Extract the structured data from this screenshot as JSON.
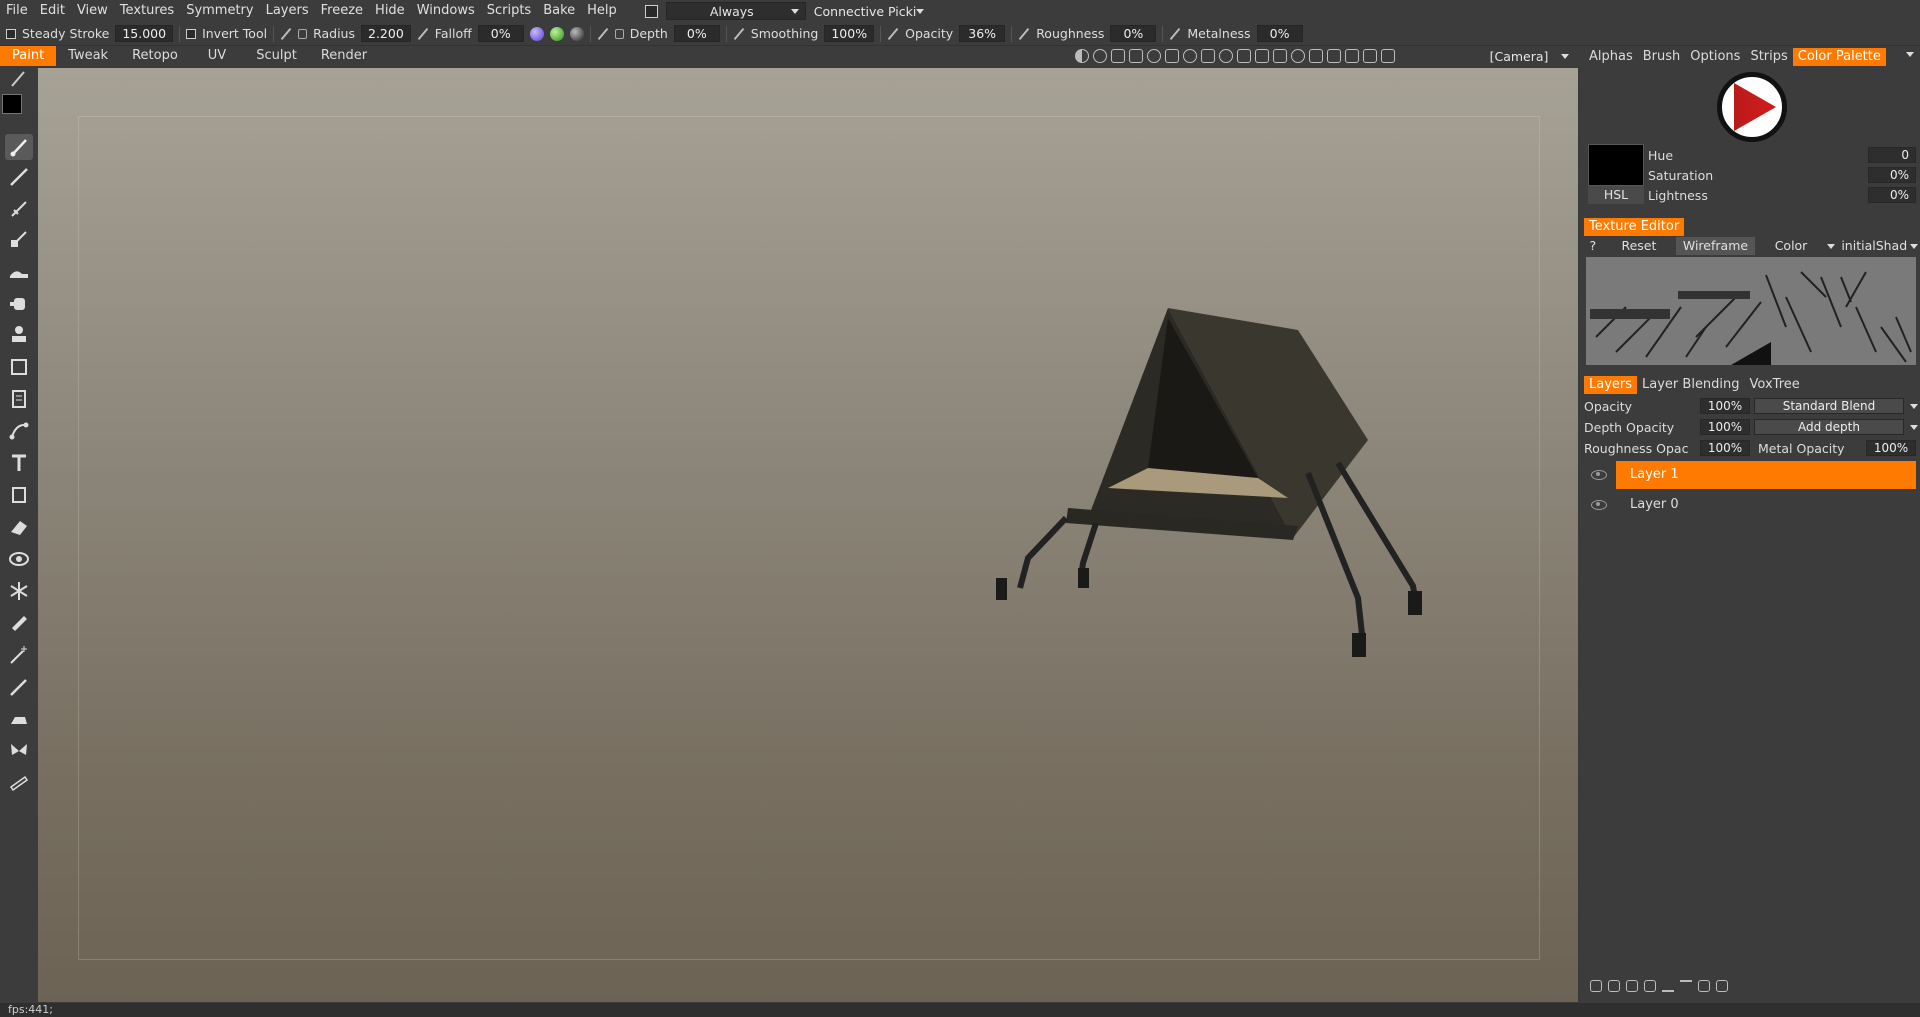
{
  "menu": {
    "items": [
      "File",
      "Edit",
      "View",
      "Textures",
      "Symmetry",
      "Layers",
      "Freeze",
      "Hide",
      "Windows",
      "Scripts",
      "Bake",
      "Help"
    ],
    "mode_dropdown": "Always",
    "pick_dropdown": "Connective Picki"
  },
  "toolbar": {
    "steady_label": "Steady  Stroke",
    "steady_value": "15.000",
    "invert_label": "Invert  Tool",
    "radius_label": "Radius",
    "radius_value": "2.200",
    "falloff_label": "Falloff",
    "falloff_value": "0%",
    "depth_label": "Depth",
    "depth_value": "0%",
    "smoothing_label": "Smoothing",
    "smoothing_value": "100%",
    "opacity_label": "Opacity",
    "opacity_value": "36%",
    "roughness_label": "Roughness",
    "roughness_value": "0%",
    "metalness_label": "Metalness",
    "metalness_value": "0%"
  },
  "modes": [
    "Paint",
    "Tweak",
    "Retopo",
    "UV",
    "Sculpt",
    "Render"
  ],
  "active_mode": "Paint",
  "camera_dropdown": "[Camera]",
  "right_tabs": [
    "Alphas",
    "Brush",
    "Options",
    "Strips",
    "Color  Palette"
  ],
  "active_right_tab": "Color  Palette",
  "color": {
    "hue_label": "Hue",
    "hue_value": "0",
    "saturation_label": "Saturation",
    "saturation_value": "0%",
    "lightness_label": "Lightness",
    "lightness_value": "0%",
    "model_button": "HSL",
    "swatch": "#000000"
  },
  "texture_editor": {
    "title": "Texture  Editor",
    "help": "?",
    "reset": "Reset",
    "wireframe": "Wireframe",
    "color": "Color",
    "shader": "initialShad"
  },
  "layers_tabs": [
    "Layers",
    "Layer  Blending",
    "VoxTree"
  ],
  "layers_props": {
    "opacity_label": "Opacity",
    "opacity_value": "100%",
    "blend_mode": "Standard  Blend",
    "depth_opacity_label": "Depth  Opacity",
    "depth_opacity_value": "100%",
    "depth_mode": "Add  depth",
    "roughness_opacity_label": "Roughness  Opac",
    "roughness_opacity_value": "100%",
    "metal_opacity_label": "Metal  Opacity",
    "metal_opacity_value": "100%"
  },
  "layers": [
    {
      "name": "Layer  1",
      "selected": true
    },
    {
      "name": "Layer  0",
      "selected": false
    }
  ],
  "status": "fps:441;",
  "colors": {
    "accent": "#ff7a00",
    "panel": "#3c3c3c",
    "field": "#2e2e2e"
  }
}
